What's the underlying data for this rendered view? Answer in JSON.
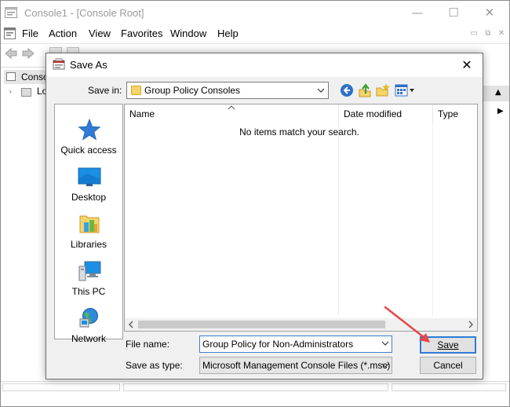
{
  "mmc": {
    "title": "Console1 - [Console Root]",
    "window_controls": {
      "minimize": "—",
      "maximize": "☐",
      "close": "✕"
    },
    "menu": [
      "File",
      "Action",
      "View",
      "Favorites",
      "Window",
      "Help"
    ],
    "mdi_controls": {
      "minimize": "▭",
      "restore": "⧉",
      "close": "✕"
    },
    "tree": {
      "root_label": "Conso",
      "child_chevron": "›",
      "child_label": "Lo"
    },
    "actions_arrows": {
      "header": "▲",
      "item": "▶"
    }
  },
  "dialog": {
    "title": "Save As",
    "close_glyph": "✕",
    "save_in_label": "Save in:",
    "save_in_value": "Group Policy Consoles",
    "places": [
      {
        "label": "Quick access",
        "icon": "star-icon"
      },
      {
        "label": "Desktop",
        "icon": "desktop-icon"
      },
      {
        "label": "Libraries",
        "icon": "libraries-icon"
      },
      {
        "label": "This PC",
        "icon": "computer-icon"
      },
      {
        "label": "Network",
        "icon": "network-icon"
      }
    ],
    "columns": {
      "name": "Name",
      "date_modified": "Date modified",
      "type": "Type"
    },
    "empty_message": "No items match your search.",
    "file_name_label": "File name:",
    "file_name_value": "Group Policy for Non-Administrators",
    "save_as_type_label": "Save as type:",
    "save_as_type_value": "Microsoft Management Console Files (*.msc)",
    "save_button": "Save",
    "cancel_button": "Cancel"
  },
  "colors": {
    "accent": "#2f7bd6",
    "annotation_arrow": "#e5474a"
  }
}
